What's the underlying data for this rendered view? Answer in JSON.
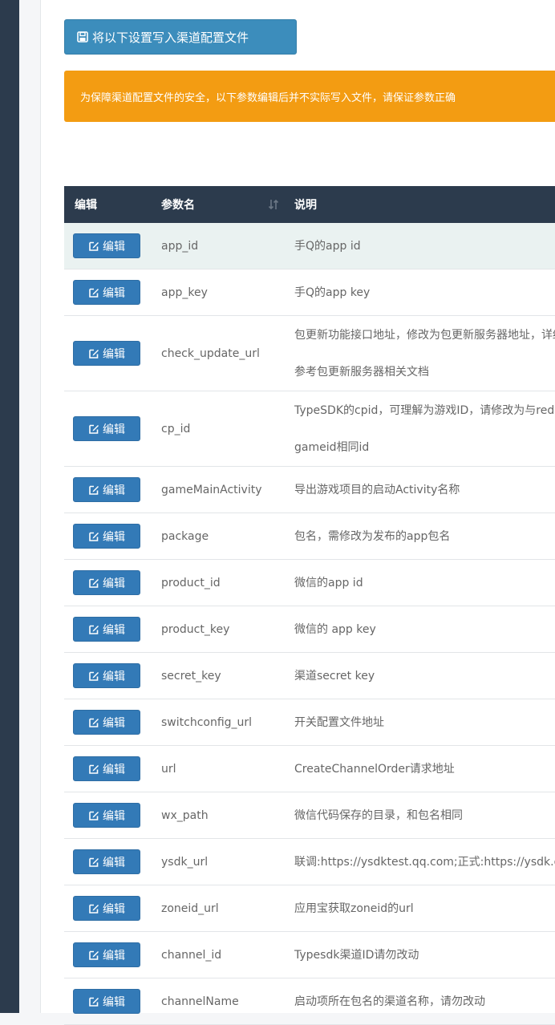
{
  "toolbar": {
    "write_label": "将以下设置写入渠道配置文件"
  },
  "alert": {
    "text": "为保障渠道配置文件的安全，以下参数编辑后并不实际写入文件，请保证参数正确"
  },
  "table": {
    "headers": {
      "edit": "编辑",
      "param": "参数名",
      "desc": "说明"
    },
    "edit_label": "编辑",
    "rows": [
      {
        "param": "app_id",
        "desc": "手Q的app id"
      },
      {
        "param": "app_key",
        "desc": "手Q的app key"
      },
      {
        "param": "check_update_url",
        "desc": "包更新功能接口地址，修改为包更新服务器地址，详细请参考包更新服务器相关文档"
      },
      {
        "param": "cp_id",
        "desc": "TypeSDK的cpid，可理解为游戏ID，请修改为与redis的gameid相同id"
      },
      {
        "param": "gameMainActivity",
        "desc": "导出游戏项目的启动Activity名称"
      },
      {
        "param": "package",
        "desc": "包名，需修改为发布的app包名"
      },
      {
        "param": "product_id",
        "desc": "微信的app id"
      },
      {
        "param": "product_key",
        "desc": "微信的 app key"
      },
      {
        "param": "secret_key",
        "desc": "渠道secret key"
      },
      {
        "param": "switchconfig_url",
        "desc": "开关配置文件地址"
      },
      {
        "param": "url",
        "desc": "CreateChannelOrder请求地址"
      },
      {
        "param": "wx_path",
        "desc": "微信代码保存的目录，和包名相同"
      },
      {
        "param": "ysdk_url",
        "desc": "联调:https://ysdktest.qq.com;正式:https://ysdk.qq.com"
      },
      {
        "param": "zoneid_url",
        "desc": "应用宝获取zoneid的url"
      },
      {
        "param": "channel_id",
        "desc": "Typesdk渠道ID请勿改动"
      },
      {
        "param": "channelName",
        "desc": "启动项所在包名的渠道名称，请勿改动"
      }
    ]
  },
  "colors": {
    "sidebar": "#2c3b4d",
    "primary_button": "#3c8dbc",
    "alert_warning": "#f39c12",
    "table_header": "#2c3b4d",
    "row_highlight": "#eaf2f1"
  },
  "icons": {
    "write_button": "save-icon",
    "edit_button": "edit-icon",
    "sort": "sort-icon"
  }
}
